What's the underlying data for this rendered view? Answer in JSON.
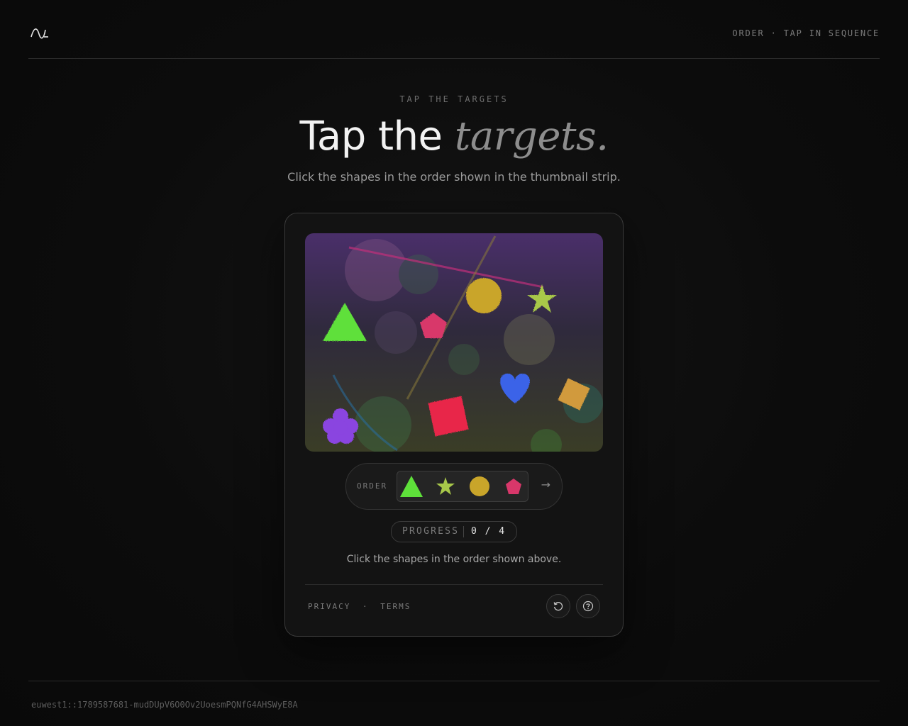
{
  "header": {
    "logo_icon": "wave-logo-icon",
    "mode_label": "ORDER · TAP IN SEQUENCE"
  },
  "hero": {
    "eyebrow": "TAP THE TARGETS",
    "title_plain": "Tap the",
    "title_emphasis": "targets.",
    "subtitle": "Click the shapes in the order shown in the thumbnail strip."
  },
  "challenge": {
    "canvas_shapes": [
      {
        "name": "triangle",
        "color": "#5ee03a"
      },
      {
        "name": "pentagon",
        "color": "#d8376a"
      },
      {
        "name": "circle",
        "color": "#c9a52a"
      },
      {
        "name": "star",
        "color": "#a8c84a"
      },
      {
        "name": "heart",
        "color": "#3b64e8"
      },
      {
        "name": "diamond",
        "color": "#d19a3c"
      },
      {
        "name": "square",
        "color": "#e8284a"
      },
      {
        "name": "flower",
        "color": "#8a44e0"
      }
    ],
    "order": {
      "label": "ORDER",
      "sequence": [
        "triangle",
        "star",
        "circle",
        "pentagon"
      ],
      "next_icon": "arrow-right-icon",
      "next_glyph": "→"
    },
    "progress": {
      "label": "PROGRESS",
      "value": "0 / 4",
      "current": 0,
      "total": 4
    },
    "instruction": "Click the shapes in the order shown above."
  },
  "footer_links": {
    "privacy": "PRIVACY",
    "separator": "·",
    "terms": "TERMS"
  },
  "actions": {
    "refresh_icon": "refresh-icon",
    "help_icon": "help-icon"
  },
  "session_id": "euwest1::1789587681-mudDUpV6O0Ov2UoesmPQNfG4AHSWyE8A",
  "colors": {
    "background": "#0b0b0b",
    "card": "#131313",
    "accent_text": "#f2f2f2",
    "muted_text": "#7a7a7a"
  }
}
